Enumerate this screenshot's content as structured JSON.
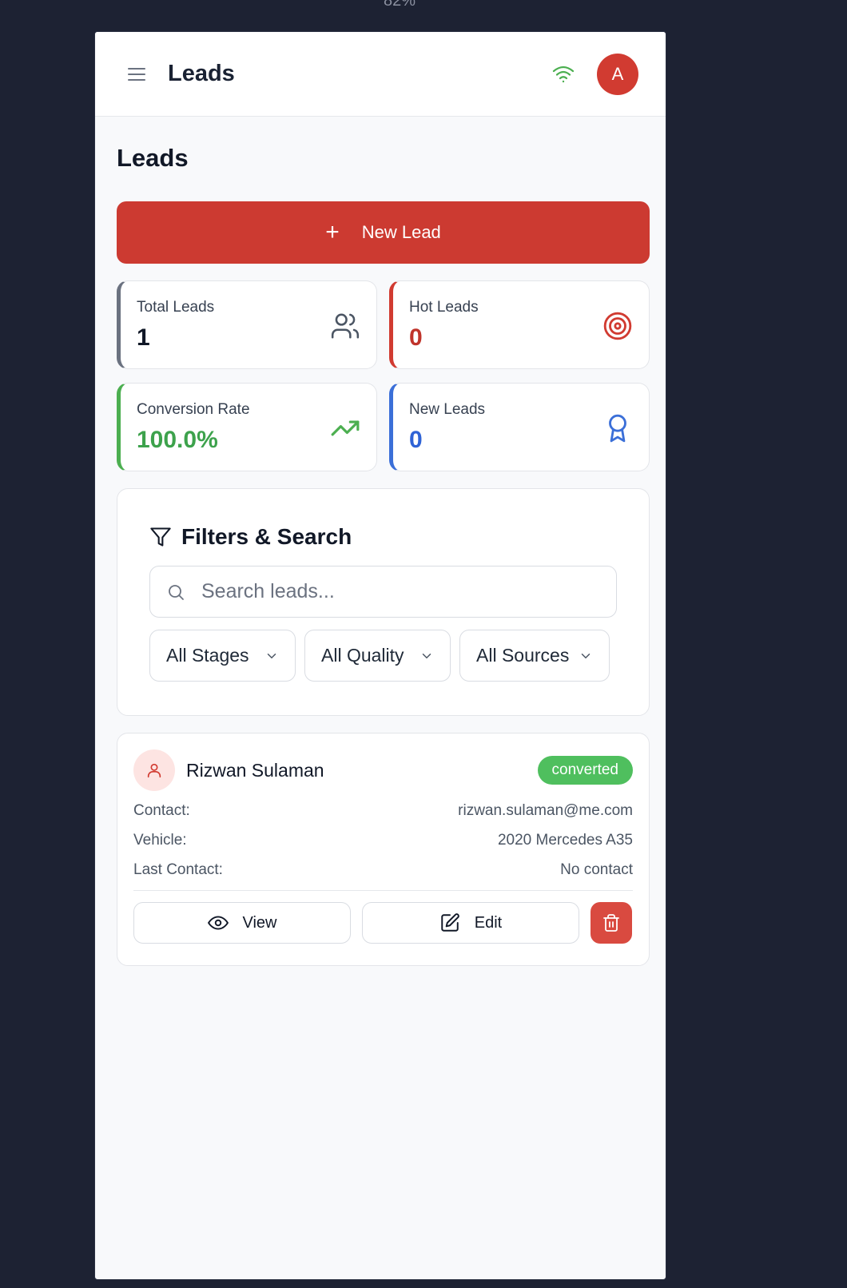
{
  "zoom_label": "82%",
  "header": {
    "title": "Leads",
    "avatar_initial": "A",
    "wifi_color": "#4caf50"
  },
  "page": {
    "title": "Leads",
    "new_lead_label": "New Lead"
  },
  "stats": [
    {
      "label": "Total Leads",
      "value": "1",
      "icon": "users-icon",
      "color": "#6b7280",
      "value_color": "#111827"
    },
    {
      "label": "Hot Leads",
      "value": "0",
      "icon": "target-icon",
      "color": "#d13b31",
      "value_color": "#c0342b"
    },
    {
      "label": "Conversion Rate",
      "value": "100.0%",
      "icon": "trending-up-icon",
      "color": "#4caf50",
      "value_color": "#3da24c"
    },
    {
      "label": "New Leads",
      "value": "0",
      "icon": "award-icon",
      "color": "#3b6fd8",
      "value_color": "#2f63d6"
    }
  ],
  "filters": {
    "title": "Filters & Search",
    "search_placeholder": "Search leads...",
    "stage": "All Stages",
    "quality": "All Quality",
    "source": "All Sources"
  },
  "lead": {
    "name": "Rizwan Sulaman",
    "status": "converted",
    "contact_label": "Contact:",
    "contact_value": "rizwan.sulaman@me.com",
    "vehicle_label": "Vehicle:",
    "vehicle_value": "2020 Mercedes A35",
    "last_contact_label": "Last Contact:",
    "last_contact_value": "No contact",
    "view_label": "View",
    "edit_label": "Edit"
  }
}
